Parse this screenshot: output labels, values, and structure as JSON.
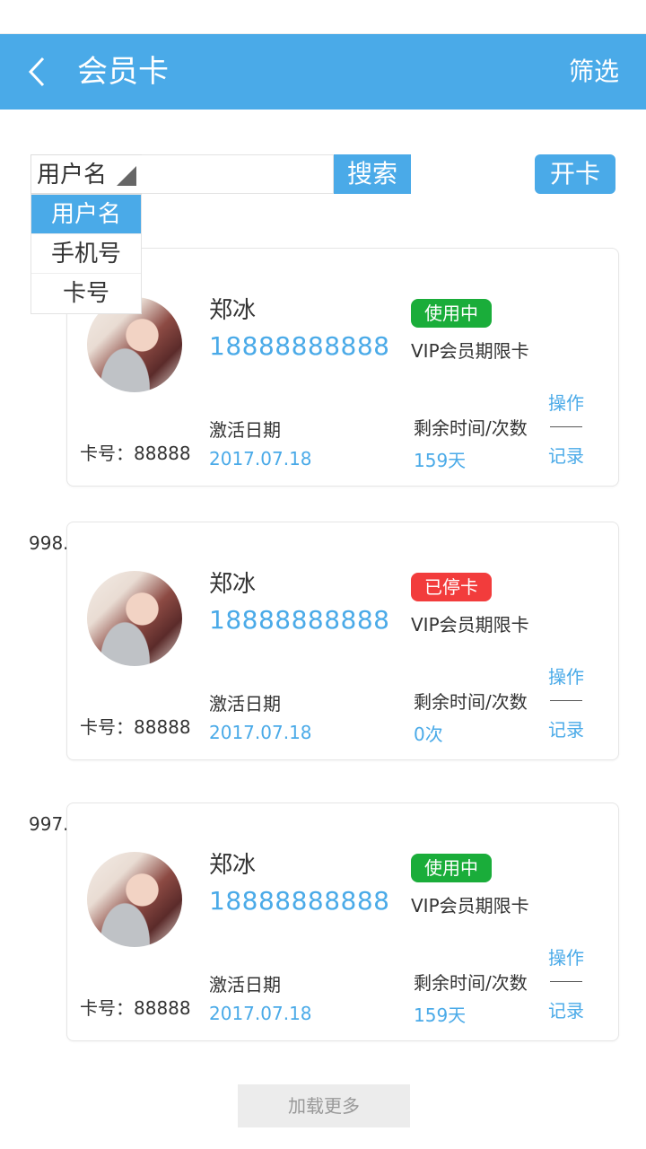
{
  "header": {
    "title": "会员卡",
    "filter_label": "筛选"
  },
  "search": {
    "type_selected": "用户名",
    "options": [
      "用户名",
      "手机号",
      "卡号"
    ],
    "button_label": "搜索",
    "value": ""
  },
  "open_card_label": "开卡",
  "colors": {
    "accent": "#4aaae8",
    "active": "#1aad3a",
    "stopped": "#f23c3c"
  },
  "members": [
    {
      "index": "",
      "name": "郑冰",
      "phone": "18888888888",
      "status": "使用中",
      "status_color": "#1aad3a",
      "card_type": "VIP会员期限卡",
      "card_no": "卡号：88888",
      "activate_label": "激活日期",
      "activate_date": "2017.07.18",
      "remain_label": "剩余时间/次数",
      "remain_value": "159天",
      "op_label": "操作",
      "record_label": "记录"
    },
    {
      "index": "998.",
      "name": "郑冰",
      "phone": "18888888888",
      "status": "已停卡",
      "status_color": "#f23c3c",
      "card_type": "VIP会员期限卡",
      "card_no": "卡号：88888",
      "activate_label": "激活日期",
      "activate_date": "2017.07.18",
      "remain_label": "剩余时间/次数",
      "remain_value": "0次",
      "op_label": "操作",
      "record_label": "记录"
    },
    {
      "index": "997.",
      "name": "郑冰",
      "phone": "18888888888",
      "status": "使用中",
      "status_color": "#1aad3a",
      "card_type": "VIP会员期限卡",
      "card_no": "卡号：88888",
      "activate_label": "激活日期",
      "activate_date": "2017.07.18",
      "remain_label": "剩余时间/次数",
      "remain_value": "159天",
      "op_label": "操作",
      "record_label": "记录"
    }
  ],
  "load_more_label": "加载更多"
}
